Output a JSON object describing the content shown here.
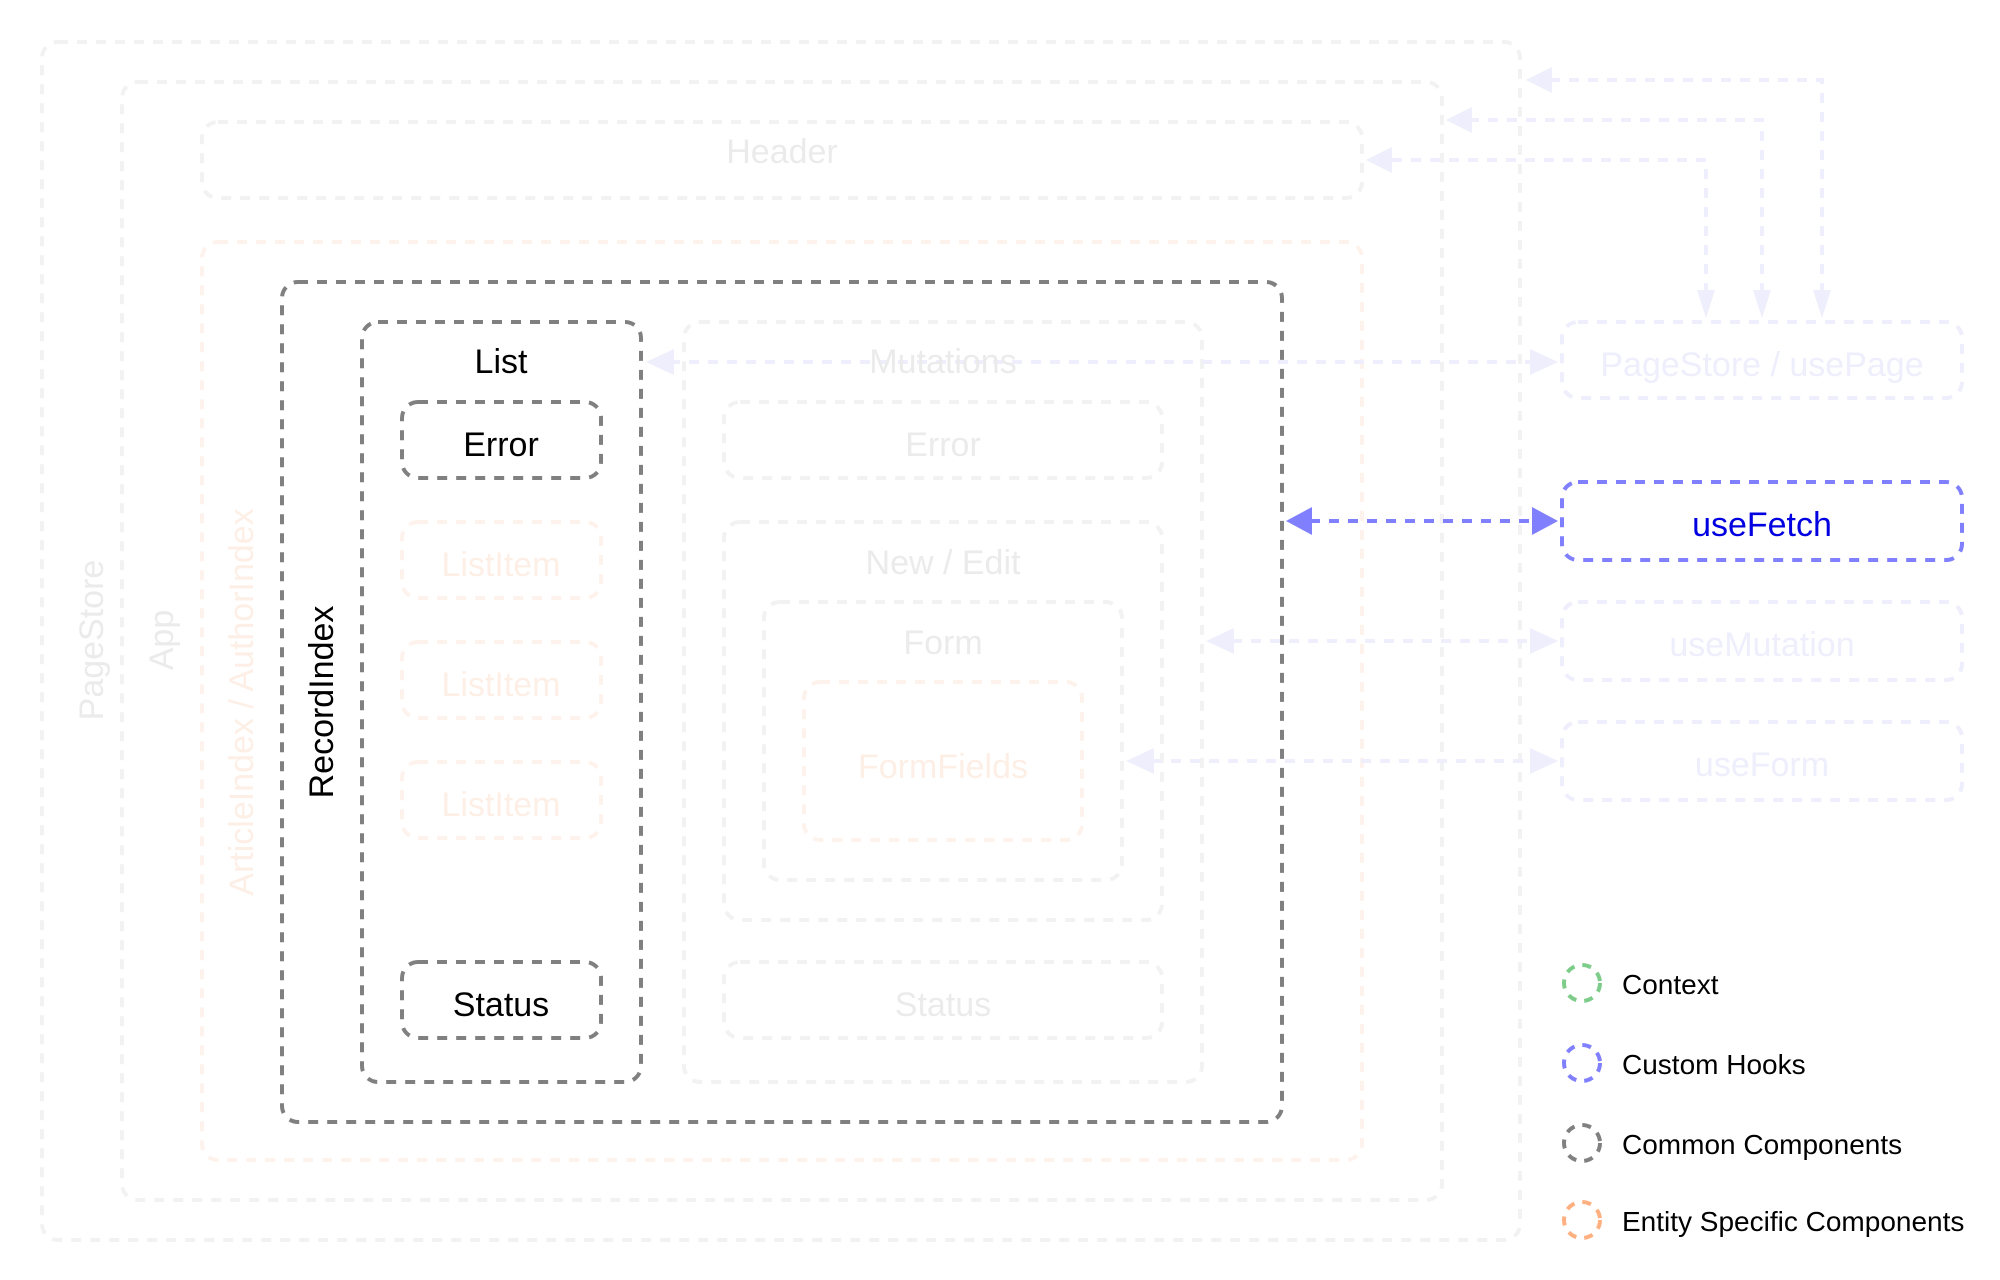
{
  "colors": {
    "faded_gray": "#ebebeb",
    "faded_orange": "#fdefe6",
    "faded_blue": "#eeeefc",
    "common_gray": "#808080",
    "hook_blue": "#8080ff",
    "hook_text": "#0000e0",
    "text_dark": "#000000",
    "legend_green": "#7dcc8a",
    "legend_blue": "#8080ff",
    "legend_gray": "#808080",
    "legend_orange": "#ffb080"
  },
  "components": {
    "page_store": "PageStore",
    "app": "App",
    "header": "Header",
    "entity_index": "ArticleIndex / AuthorIndex",
    "record_index": "RecordIndex",
    "list": {
      "title": "List",
      "error": "Error",
      "items": [
        "ListItem",
        "ListItem",
        "ListItem"
      ],
      "status": "Status"
    },
    "mutations": {
      "title": "Mutations",
      "error": "Error",
      "new_edit": "New / Edit",
      "form": "Form",
      "form_fields": "FormFields",
      "status": "Status"
    }
  },
  "hooks": {
    "page_store_use_page": "PageStore / usePage",
    "use_fetch": "useFetch",
    "use_mutation": "useMutation",
    "use_form": "useForm"
  },
  "legend": [
    {
      "label": "Context",
      "color_key": "legend_green"
    },
    {
      "label": "Custom Hooks",
      "color_key": "legend_blue"
    },
    {
      "label": "Common Components",
      "color_key": "legend_gray"
    },
    {
      "label": "Entity Specific Components",
      "color_key": "legend_orange"
    }
  ]
}
